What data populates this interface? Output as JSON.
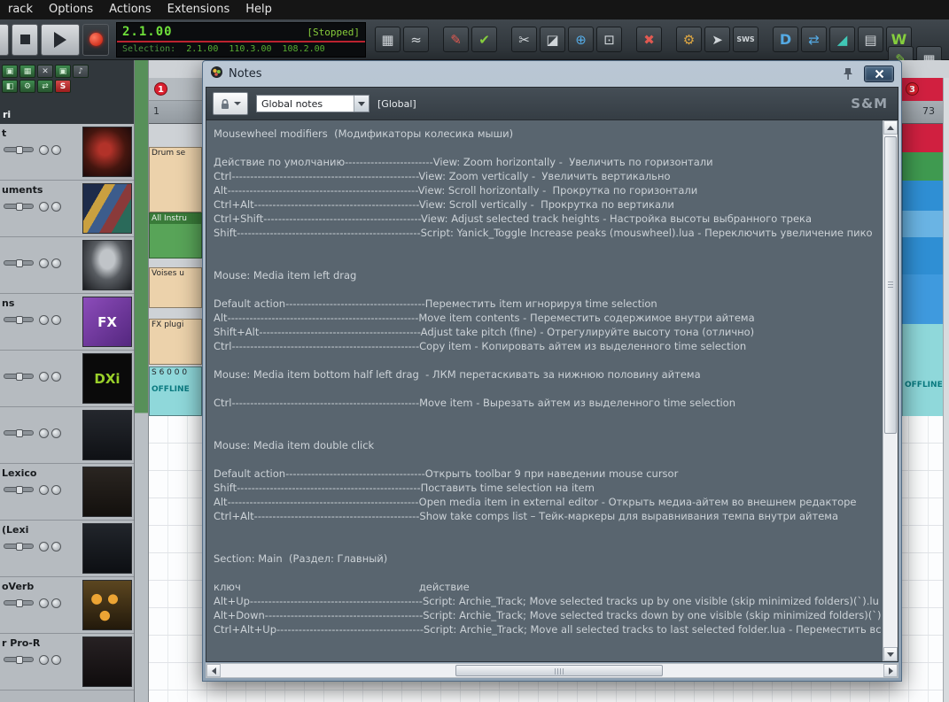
{
  "menu": {
    "items": [
      "rack",
      "Options",
      "Actions",
      "Extensions",
      "Help"
    ]
  },
  "transport": {
    "time": "2.1.00",
    "status": "[Stopped]",
    "selection_label": "Selection:",
    "selection_start": "2.1.00",
    "selection_end": "110.3.00",
    "selection_length": "108.2.00"
  },
  "toolbar": {
    "icons": [
      {
        "name": "matrix-icon",
        "glyph": "▦"
      },
      {
        "name": "envelope-icon",
        "glyph": "≈"
      },
      {
        "name": "automation-icon",
        "glyph": "✎"
      },
      {
        "name": "check-icon",
        "glyph": "✔"
      },
      {
        "name": "scissors-icon",
        "glyph": "✂"
      },
      {
        "name": "eraser-icon",
        "glyph": "◪"
      },
      {
        "name": "zoom-in-icon",
        "glyph": "⊕"
      },
      {
        "name": "zoom-select-icon",
        "glyph": "⊡"
      },
      {
        "name": "remove-fx-icon",
        "glyph": "✖"
      },
      {
        "name": "wrench-icon",
        "glyph": "⚙"
      },
      {
        "name": "cursor-icon",
        "glyph": "➤"
      },
      {
        "name": "sws-badge-icon",
        "glyph": "SWS"
      },
      {
        "name": "docker-icon",
        "glyph": "D"
      },
      {
        "name": "swap-icon",
        "glyph": "⇄"
      },
      {
        "name": "node-icon",
        "glyph": "◢"
      },
      {
        "name": "grid-edit-icon",
        "glyph": "▤"
      },
      {
        "name": "write-icon",
        "glyph": "W"
      },
      {
        "name": "pencil-icon",
        "glyph": "✎"
      },
      {
        "name": "grid-icon",
        "glyph": "▦"
      }
    ]
  },
  "tracks": {
    "partial_label": "ri",
    "cluster_buttons": [
      {
        "name": "fx-chain-button",
        "glyph": "▣"
      },
      {
        "name": "routing-button",
        "glyph": "▦"
      },
      {
        "name": "remove-button",
        "glyph": "✕"
      },
      {
        "name": "monitor-button",
        "glyph": "▣"
      },
      {
        "name": "midi-button",
        "glyph": "♪"
      },
      {
        "name": "phase-button",
        "glyph": "◧"
      },
      {
        "name": "settings-button",
        "glyph": "⚙"
      },
      {
        "name": "link-button",
        "glyph": "⇄"
      },
      {
        "name": "solo-button",
        "glyph": "S"
      }
    ],
    "rows": [
      {
        "name": "t"
      },
      {
        "name": "uments"
      },
      {
        "name": ""
      },
      {
        "name": "ns",
        "thumb_label": "FX"
      },
      {
        "name": "",
        "thumb_label": "DXi"
      },
      {
        "name": ""
      },
      {
        "name": "Lexico"
      },
      {
        "name": "(Lexi"
      },
      {
        "name": "oVerb"
      },
      {
        "name": "r Pro-R"
      }
    ]
  },
  "timeline": {
    "ruler_start": "1",
    "ruler_end": "73",
    "marker_left": "1",
    "marker_right": "3",
    "clips": {
      "drums": "Drum se",
      "instruments": "All Instru",
      "voices": "Voises u",
      "fx": "FX plugi",
      "sampler": "S 6 0 0 0",
      "sampler_state": "OFFLINE",
      "right_state": "OFFLINE"
    }
  },
  "notes_window": {
    "title": "Notes",
    "dropdown_value": "Global notes",
    "scope_label": "[Global]",
    "brand": "S&M",
    "lines": [
      "Mousewheel modifiers  (Модификаторы колесика мыши)",
      "",
      "Действие по умолчанию------------------------View: Zoom horizontally -  Увеличить по горизонтали",
      "Ctrl---------------------------------------------------View: Zoom vertically -  Увеличить вертикально",
      "Alt----------------------------------------------------View: Scroll horizontally -  Прокрутка по горизонтали",
      "Ctrl+Alt---------------------------------------------View: Scroll vertically -  Прокрутка по вертикали",
      "Ctrl+Shift-------------------------------------------View: Adjust selected track heights - Настройка высоты выбранного трека",
      "Shift--------------------------------------------------Script: Yanick_Toggle Increase peaks (mouswheel).lua - Переключить увеличение пико",
      "",
      "",
      "Mouse: Media item left drag",
      "",
      "Default action--------------------------------------Переместить item игнорируя time selection",
      "Alt----------------------------------------------------Move item contents - Переместить содержимое внутри айтема",
      "Shift+Alt--------------------------------------------Adjust take pitch (fine) - Отрегулируйте высоту тона (отлично)",
      "Ctrl---------------------------------------------------Copy item - Копировать айтем из выделенного time selection",
      "",
      "Mouse: Media item bottom half left drag  - ЛКМ перетаскивать за нижнюю половину айтема",
      "",
      "Ctrl---------------------------------------------------Move item - Вырезать айтем из выделенного time selection",
      "",
      "",
      "Mouse: Media item double click",
      "",
      "Default action--------------------------------------Открыть toolbar 9 при наведении mouse cursor",
      "Shift--------------------------------------------------Поставить time selection на item",
      "Alt----------------------------------------------------Open media item in external editor - Открыть медиа-айтем во внешнем редакторе",
      "Ctrl+Alt---------------------------------------------Show take comps list – Тейк-маркеры для выравнивания темпа внутри айтема",
      "",
      "",
      "Section: Main  (Раздел: Главный)",
      "",
      "ключ                                                       действие",
      "Alt+Up-----------------------------------------------Script: Archie_Track; Move selected tracks up by one visible (skip minimized folders)(`).lu",
      "Alt+Down-------------------------------------------Script: Archie_Track; Move selected tracks down by one visible (skip minimized folders)(`)",
      "Ctrl+Alt+Up----------------------------------------Script: Archie_Track; Move all selected tracks to last selected folder.lua - Переместить вс"
    ]
  },
  "colors": {
    "lcd_green": "#6fe03a",
    "status_green": "#86cc3a",
    "divider_red": "#bc2330",
    "region_red": "#d12040",
    "clip_peach": "#ecd2ab",
    "clip_green": "#58a458",
    "clip_blue": "#2f8fd4",
    "clip_cyan": "#8fd8da",
    "notes_bg": "#59656f",
    "notes_text": "#ccd2d7"
  }
}
